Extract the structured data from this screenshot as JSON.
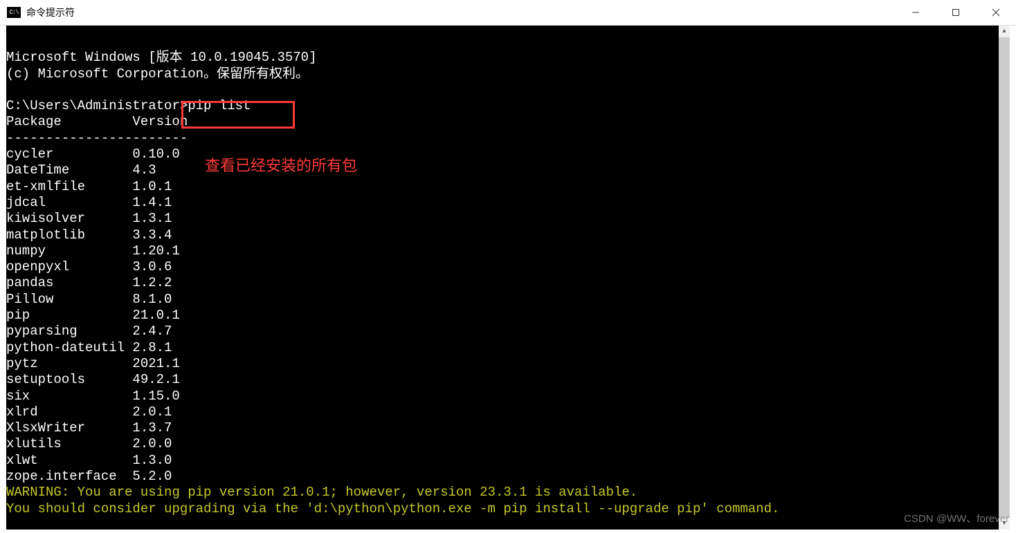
{
  "window": {
    "title": "命令提示符",
    "icon_label": "C:\\"
  },
  "header_lines": [
    "Microsoft Windows [版本 10.0.19045.3570]",
    "(c) Microsoft Corporation。保留所有权利。"
  ],
  "prompt_path": "C:\\Users\\Administrator>",
  "command": "pip list",
  "table_headers": {
    "col1": "Package",
    "col2": "Version"
  },
  "separator": {
    "col1": "----------------",
    "col2": "-------"
  },
  "packages": [
    {
      "name": "cycler",
      "version": "0.10.0"
    },
    {
      "name": "DateTime",
      "version": "4.3"
    },
    {
      "name": "et-xmlfile",
      "version": "1.0.1"
    },
    {
      "name": "jdcal",
      "version": "1.4.1"
    },
    {
      "name": "kiwisolver",
      "version": "1.3.1"
    },
    {
      "name": "matplotlib",
      "version": "3.3.4"
    },
    {
      "name": "numpy",
      "version": "1.20.1"
    },
    {
      "name": "openpyxl",
      "version": "3.0.6"
    },
    {
      "name": "pandas",
      "version": "1.2.2"
    },
    {
      "name": "Pillow",
      "version": "8.1.0"
    },
    {
      "name": "pip",
      "version": "21.0.1"
    },
    {
      "name": "pyparsing",
      "version": "2.4.7"
    },
    {
      "name": "python-dateutil",
      "version": "2.8.1"
    },
    {
      "name": "pytz",
      "version": "2021.1"
    },
    {
      "name": "setuptools",
      "version": "49.2.1"
    },
    {
      "name": "six",
      "version": "1.15.0"
    },
    {
      "name": "xlrd",
      "version": "2.0.1"
    },
    {
      "name": "XlsxWriter",
      "version": "1.3.7"
    },
    {
      "name": "xlutils",
      "version": "2.0.0"
    },
    {
      "name": "xlwt",
      "version": "1.3.0"
    },
    {
      "name": "zope.interface",
      "version": "5.2.0"
    }
  ],
  "warning_lines": [
    "WARNING: You are using pip version 21.0.1; however, version 23.3.1 is available.",
    "You should consider upgrading via the 'd:\\python\\python.exe -m pip install --upgrade pip' command."
  ],
  "annotation": "查看已经安装的所有包",
  "watermark": "CSDN @WW、forever"
}
